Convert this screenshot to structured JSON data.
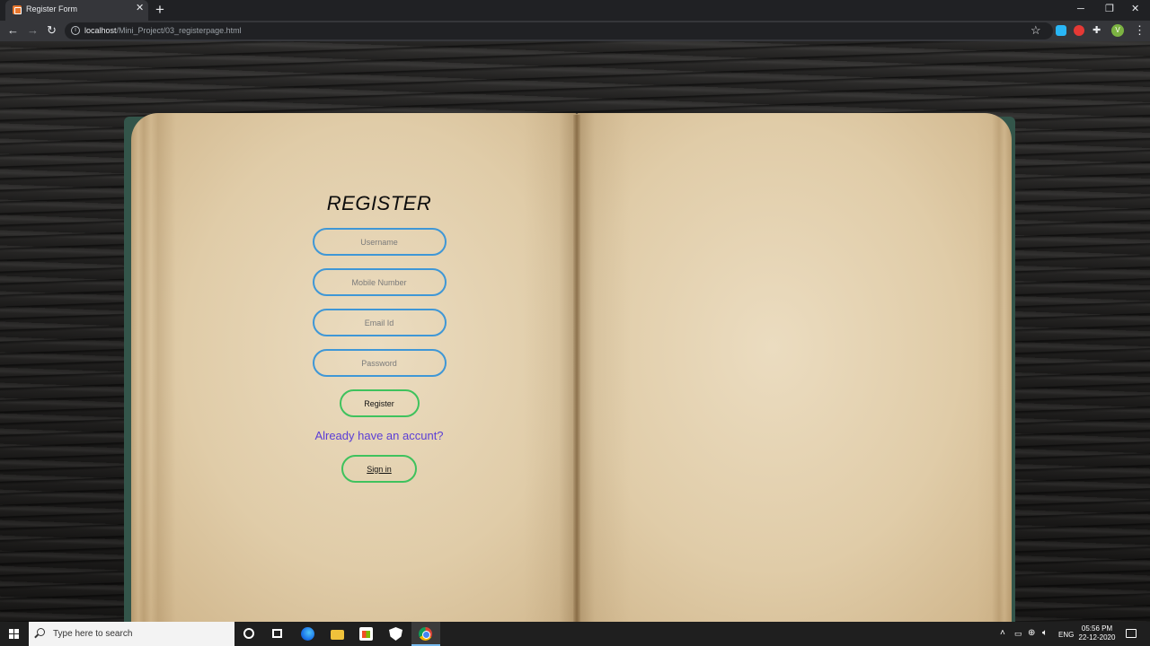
{
  "browser": {
    "tab_title": "Register Form",
    "tab_close": "✕",
    "new_tab": "+",
    "url_host": "localhost",
    "url_path": "/Mini_Project/03_registerpage.html",
    "profile_initial": "V",
    "window_controls": {
      "minimize": "─",
      "restore": "❐",
      "close": "✕"
    }
  },
  "form": {
    "title": "REGISTER",
    "username_placeholder": "Username",
    "mobile_placeholder": "Mobile Number",
    "email_placeholder": "Email Id",
    "password_placeholder": "Password",
    "register_label": "Register",
    "already_text": "Already have an accunt?",
    "signin_label": "Sign in"
  },
  "taskbar": {
    "search_placeholder": "Type here to search",
    "language": "ENG",
    "time": "05:56 PM",
    "date": "22-12-2020"
  },
  "colors": {
    "input_border": "#3f97d6",
    "button_border": "#3fc25d",
    "link_text": "#5b3ed6",
    "book_cover": "#33554a"
  },
  "icons": {
    "nav": [
      "back-icon",
      "forward-icon",
      "reload-icon"
    ],
    "tray": [
      "chevron-up-icon",
      "battery-icon",
      "network-icon",
      "volume-icon"
    ]
  }
}
